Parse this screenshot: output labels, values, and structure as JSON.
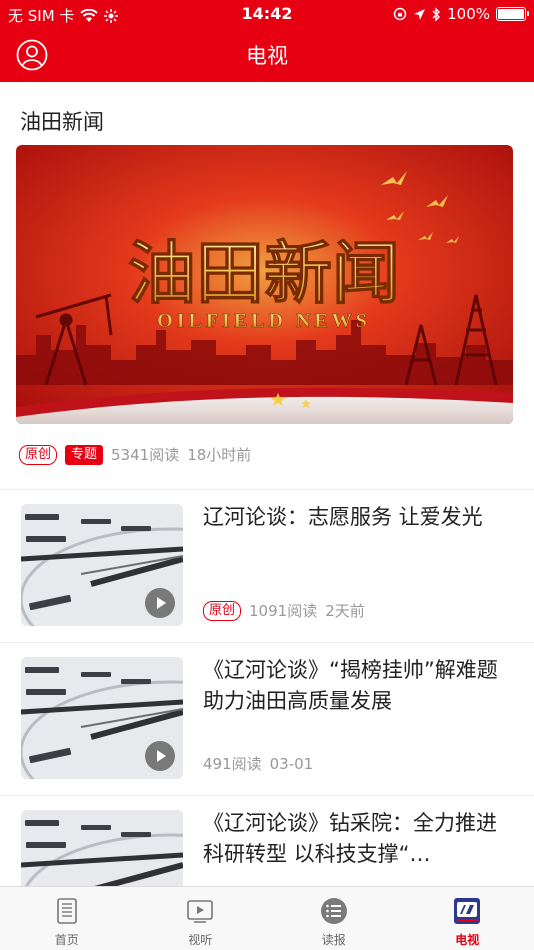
{
  "status_bar": {
    "carrier": "无 SIM 卡",
    "time": "14:42",
    "battery": "100%"
  },
  "nav": {
    "title": "电视"
  },
  "section": {
    "title": "油田新闻"
  },
  "hero": {
    "banner_text": "油田新闻",
    "banner_subtext": "OILFIELD NEWS",
    "tags": [
      "原创",
      "专题"
    ],
    "reads": "5341阅读",
    "time": "18小时前"
  },
  "items": [
    {
      "title": "辽河论谈：志愿服务  让爱发光",
      "tag": "原创",
      "reads": "1091阅读",
      "time": "2天前"
    },
    {
      "title": "《辽河论谈》“揭榜挂帅”解难题  助力油田高质量发展",
      "reads": "491阅读",
      "time": "03-01"
    },
    {
      "title": "《辽河论谈》钻采院：全力推进科研转型 以科技支撑“…"
    }
  ],
  "tabs": [
    {
      "label": "首页",
      "icon": "newspaper-icon"
    },
    {
      "label": "视听",
      "icon": "video-player-icon"
    },
    {
      "label": "读报",
      "icon": "list-circle-icon"
    },
    {
      "label": "电视",
      "icon": "tv-logo-icon",
      "active": true
    }
  ],
  "colors": {
    "brand_red": "#e60012",
    "meta_gray": "#999999"
  }
}
